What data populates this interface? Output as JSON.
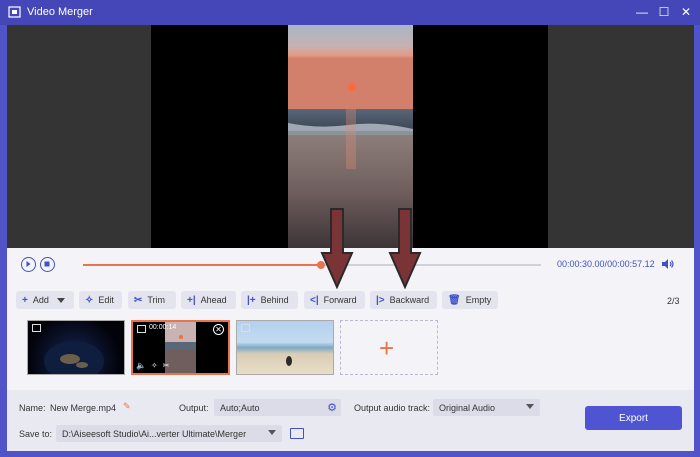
{
  "window": {
    "title": "Video Merger",
    "minimize": "—",
    "maximize": "☐",
    "close": "✕"
  },
  "player": {
    "current_time": "00:00:30.00",
    "separator": "/",
    "total_time": "00:00:57.12",
    "progress": 0.52,
    "accent": "#e8744e",
    "brand": "#3f51c6"
  },
  "toolbar": {
    "add": "Add",
    "edit": "Edit",
    "trim": "Trim",
    "ahead": "Ahead",
    "behind": "Behind",
    "forward": "Forward",
    "backward": "Backward",
    "empty": "Empty",
    "page": "2/3"
  },
  "clips": [
    {
      "name": "earth",
      "duration": ""
    },
    {
      "name": "sunset",
      "duration": "00:00:14"
    },
    {
      "name": "beach",
      "duration": ""
    }
  ],
  "settings": {
    "name_label": "Name:",
    "name_value": "New Merge.mp4",
    "output_label": "Output:",
    "output_value": "Auto;Auto",
    "audio_label": "Output audio track:",
    "audio_value": "Original Audio",
    "save_label": "Save to:",
    "save_value": "D:\\Aiseesoft Studio\\Ai...verter Ultimate\\Merger",
    "export": "Export"
  }
}
